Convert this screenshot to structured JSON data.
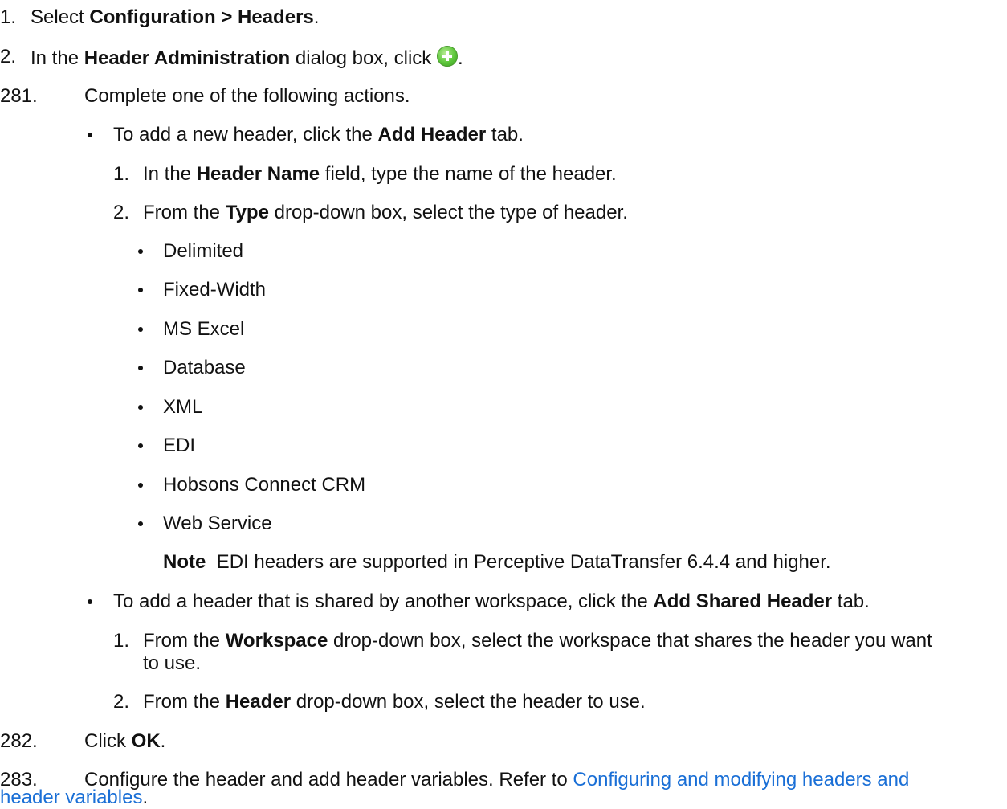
{
  "steps": [
    {
      "num": "1.",
      "pre": "Select ",
      "bold": "Configuration > Headers",
      "post": "."
    },
    {
      "num": "2.",
      "pre": "In the ",
      "bold": "Header Administration",
      "mid": " dialog box, click ",
      "post": "."
    },
    {
      "num": "281.",
      "text": "Complete one of the following actions."
    },
    {
      "num": "282.",
      "pre": "Click ",
      "bold": "OK",
      "post": "."
    },
    {
      "num": "283.",
      "text": "Configure the header and add header variables. Refer to ",
      "link": "Configuring and modifying headers and",
      "link2": "header variables",
      "post": "."
    }
  ],
  "add_header": {
    "pre": "To add a new header, click the ",
    "bold": "Add Header",
    "post": " tab.",
    "sub": [
      {
        "num": "1.",
        "pre": "In the ",
        "bold": "Header Name",
        "post": " field, type the name of the header."
      },
      {
        "num": "2.",
        "pre": "From the ",
        "bold": "Type",
        "post": " drop-down box, select the type of header."
      }
    ],
    "types": [
      "Delimited",
      "Fixed-Width",
      "MS Excel",
      "Database",
      "XML",
      "EDI",
      "Hobsons Connect CRM",
      "Web Service"
    ],
    "note_label": "Note",
    "note_text": "  EDI headers are supported in Perceptive DataTransfer 6.4.4 and higher."
  },
  "add_shared": {
    "pre": "To add a header that is shared by another workspace, click the ",
    "bold": "Add Shared Header",
    "post": " tab.",
    "sub": [
      {
        "num": "1.",
        "pre": "From the ",
        "bold": "Workspace",
        "post": " drop-down box, select the workspace that shares the header you want",
        "cont": "to use."
      },
      {
        "num": "2.",
        "pre": "From the ",
        "bold": "Header",
        "post": " drop-down box, select the header to use."
      }
    ]
  },
  "colors": {
    "text": "#111111",
    "link": "#1a6fd6",
    "add_icon": "#5cc63a"
  },
  "icons": {
    "add": "green-plus-circle-icon"
  }
}
